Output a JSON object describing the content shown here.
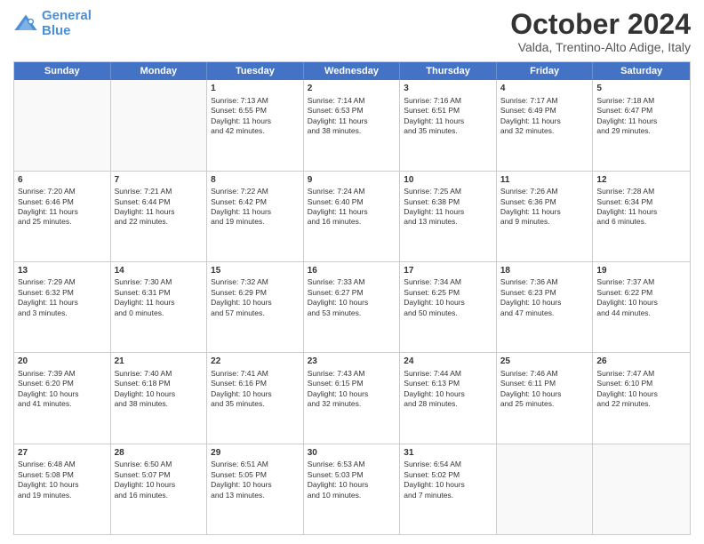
{
  "logo": {
    "line1": "General",
    "line2": "Blue"
  },
  "title": "October 2024",
  "location": "Valda, Trentino-Alto Adige, Italy",
  "days_of_week": [
    "Sunday",
    "Monday",
    "Tuesday",
    "Wednesday",
    "Thursday",
    "Friday",
    "Saturday"
  ],
  "rows": [
    [
      {
        "day": "",
        "lines": [],
        "empty": true
      },
      {
        "day": "",
        "lines": [],
        "empty": true
      },
      {
        "day": "1",
        "lines": [
          "Sunrise: 7:13 AM",
          "Sunset: 6:55 PM",
          "Daylight: 11 hours",
          "and 42 minutes."
        ]
      },
      {
        "day": "2",
        "lines": [
          "Sunrise: 7:14 AM",
          "Sunset: 6:53 PM",
          "Daylight: 11 hours",
          "and 38 minutes."
        ]
      },
      {
        "day": "3",
        "lines": [
          "Sunrise: 7:16 AM",
          "Sunset: 6:51 PM",
          "Daylight: 11 hours",
          "and 35 minutes."
        ]
      },
      {
        "day": "4",
        "lines": [
          "Sunrise: 7:17 AM",
          "Sunset: 6:49 PM",
          "Daylight: 11 hours",
          "and 32 minutes."
        ]
      },
      {
        "day": "5",
        "lines": [
          "Sunrise: 7:18 AM",
          "Sunset: 6:47 PM",
          "Daylight: 11 hours",
          "and 29 minutes."
        ]
      }
    ],
    [
      {
        "day": "6",
        "lines": [
          "Sunrise: 7:20 AM",
          "Sunset: 6:46 PM",
          "Daylight: 11 hours",
          "and 25 minutes."
        ]
      },
      {
        "day": "7",
        "lines": [
          "Sunrise: 7:21 AM",
          "Sunset: 6:44 PM",
          "Daylight: 11 hours",
          "and 22 minutes."
        ]
      },
      {
        "day": "8",
        "lines": [
          "Sunrise: 7:22 AM",
          "Sunset: 6:42 PM",
          "Daylight: 11 hours",
          "and 19 minutes."
        ]
      },
      {
        "day": "9",
        "lines": [
          "Sunrise: 7:24 AM",
          "Sunset: 6:40 PM",
          "Daylight: 11 hours",
          "and 16 minutes."
        ]
      },
      {
        "day": "10",
        "lines": [
          "Sunrise: 7:25 AM",
          "Sunset: 6:38 PM",
          "Daylight: 11 hours",
          "and 13 minutes."
        ]
      },
      {
        "day": "11",
        "lines": [
          "Sunrise: 7:26 AM",
          "Sunset: 6:36 PM",
          "Daylight: 11 hours",
          "and 9 minutes."
        ]
      },
      {
        "day": "12",
        "lines": [
          "Sunrise: 7:28 AM",
          "Sunset: 6:34 PM",
          "Daylight: 11 hours",
          "and 6 minutes."
        ]
      }
    ],
    [
      {
        "day": "13",
        "lines": [
          "Sunrise: 7:29 AM",
          "Sunset: 6:32 PM",
          "Daylight: 11 hours",
          "and 3 minutes."
        ]
      },
      {
        "day": "14",
        "lines": [
          "Sunrise: 7:30 AM",
          "Sunset: 6:31 PM",
          "Daylight: 11 hours",
          "and 0 minutes."
        ]
      },
      {
        "day": "15",
        "lines": [
          "Sunrise: 7:32 AM",
          "Sunset: 6:29 PM",
          "Daylight: 10 hours",
          "and 57 minutes."
        ]
      },
      {
        "day": "16",
        "lines": [
          "Sunrise: 7:33 AM",
          "Sunset: 6:27 PM",
          "Daylight: 10 hours",
          "and 53 minutes."
        ]
      },
      {
        "day": "17",
        "lines": [
          "Sunrise: 7:34 AM",
          "Sunset: 6:25 PM",
          "Daylight: 10 hours",
          "and 50 minutes."
        ]
      },
      {
        "day": "18",
        "lines": [
          "Sunrise: 7:36 AM",
          "Sunset: 6:23 PM",
          "Daylight: 10 hours",
          "and 47 minutes."
        ]
      },
      {
        "day": "19",
        "lines": [
          "Sunrise: 7:37 AM",
          "Sunset: 6:22 PM",
          "Daylight: 10 hours",
          "and 44 minutes."
        ]
      }
    ],
    [
      {
        "day": "20",
        "lines": [
          "Sunrise: 7:39 AM",
          "Sunset: 6:20 PM",
          "Daylight: 10 hours",
          "and 41 minutes."
        ]
      },
      {
        "day": "21",
        "lines": [
          "Sunrise: 7:40 AM",
          "Sunset: 6:18 PM",
          "Daylight: 10 hours",
          "and 38 minutes."
        ]
      },
      {
        "day": "22",
        "lines": [
          "Sunrise: 7:41 AM",
          "Sunset: 6:16 PM",
          "Daylight: 10 hours",
          "and 35 minutes."
        ]
      },
      {
        "day": "23",
        "lines": [
          "Sunrise: 7:43 AM",
          "Sunset: 6:15 PM",
          "Daylight: 10 hours",
          "and 32 minutes."
        ]
      },
      {
        "day": "24",
        "lines": [
          "Sunrise: 7:44 AM",
          "Sunset: 6:13 PM",
          "Daylight: 10 hours",
          "and 28 minutes."
        ]
      },
      {
        "day": "25",
        "lines": [
          "Sunrise: 7:46 AM",
          "Sunset: 6:11 PM",
          "Daylight: 10 hours",
          "and 25 minutes."
        ]
      },
      {
        "day": "26",
        "lines": [
          "Sunrise: 7:47 AM",
          "Sunset: 6:10 PM",
          "Daylight: 10 hours",
          "and 22 minutes."
        ]
      }
    ],
    [
      {
        "day": "27",
        "lines": [
          "Sunrise: 6:48 AM",
          "Sunset: 5:08 PM",
          "Daylight: 10 hours",
          "and 19 minutes."
        ]
      },
      {
        "day": "28",
        "lines": [
          "Sunrise: 6:50 AM",
          "Sunset: 5:07 PM",
          "Daylight: 10 hours",
          "and 16 minutes."
        ]
      },
      {
        "day": "29",
        "lines": [
          "Sunrise: 6:51 AM",
          "Sunset: 5:05 PM",
          "Daylight: 10 hours",
          "and 13 minutes."
        ]
      },
      {
        "day": "30",
        "lines": [
          "Sunrise: 6:53 AM",
          "Sunset: 5:03 PM",
          "Daylight: 10 hours",
          "and 10 minutes."
        ]
      },
      {
        "day": "31",
        "lines": [
          "Sunrise: 6:54 AM",
          "Sunset: 5:02 PM",
          "Daylight: 10 hours",
          "and 7 minutes."
        ]
      },
      {
        "day": "",
        "lines": [],
        "empty": true
      },
      {
        "day": "",
        "lines": [],
        "empty": true
      }
    ]
  ]
}
